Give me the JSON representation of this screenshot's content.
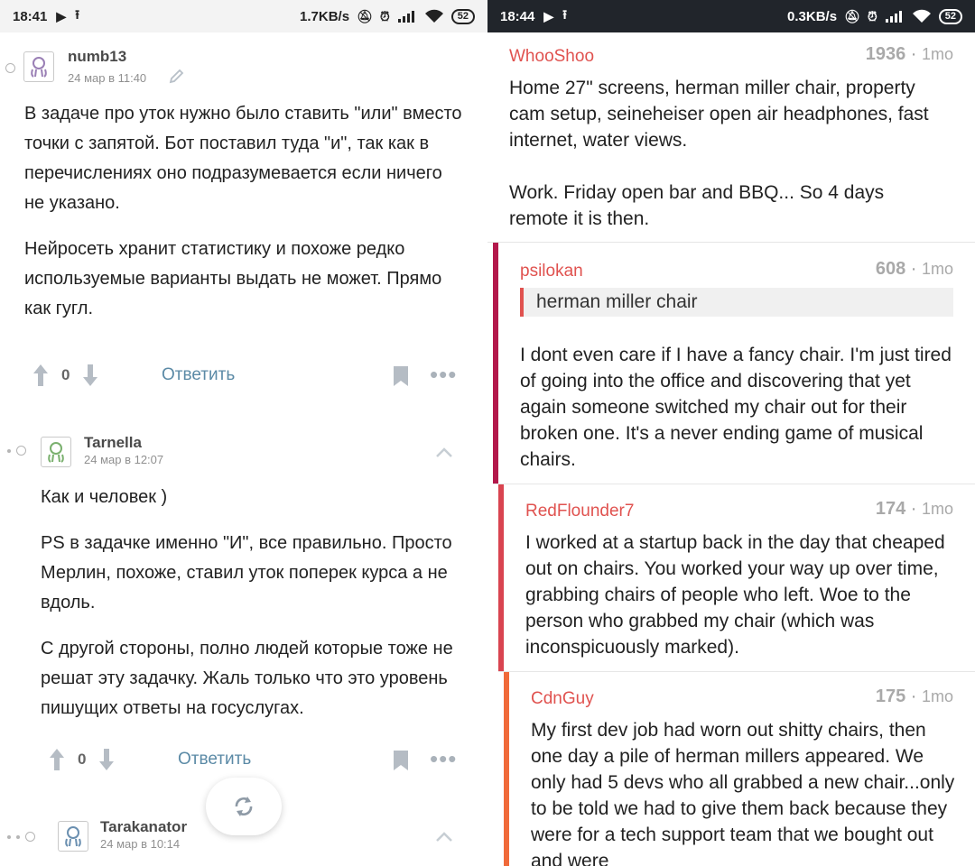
{
  "left": {
    "status": {
      "time": "18:41",
      "speed": "1.7KB/s",
      "battery": "52"
    },
    "comments": [
      {
        "author": "numb13",
        "date": "24 мар в 11:40",
        "paragraphs": [
          "В задаче про уток нужно было ставить \"или\" вместо точки с запятой. Бот поставил туда \"и\", так как в перечислениях оно подразумевается если ничего не указано.",
          "Нейросеть хранит статистику и похоже редко используемые варианты выдать не может. Прямо как гугл."
        ],
        "votes": "0",
        "reply_label": "Ответить"
      },
      {
        "author": "Tarnella",
        "date": "24 мар в 12:07",
        "paragraphs": [
          "Как и человек )",
          "PS в задачке именно \"И\", все правильно. Просто Мерлин, похоже, ставил уток поперек курса а не вдоль.",
          "С другой стороны, полно людей которые тоже не решат эту задачку. Жаль только что это уровень пишущих ответы на госуслугах."
        ],
        "votes": "0",
        "reply_label": "Ответить"
      },
      {
        "author": "Tarakanator",
        "date": "24 мар в 10:14"
      }
    ]
  },
  "right": {
    "status": {
      "time": "18:44",
      "speed": "0.3KB/s",
      "battery": "52"
    },
    "comments": [
      {
        "author": "WhooShoo",
        "score": "1936",
        "age": "1mo",
        "paragraphs": [
          "Home 27\" screens, herman miller chair, property cam setup, seineheiser open air headphones, fast internet, water views.",
          "Work. Friday open bar and BBQ... So 4 days remote it is then."
        ]
      },
      {
        "author": "psilokan",
        "score": "608",
        "age": "1mo",
        "quote": "herman miller chair",
        "paragraphs": [
          "I dont even care if I have a fancy chair. I'm just tired of going into the office and discovering that yet again someone switched my chair out for their broken one. It's a never ending game of musical chairs."
        ]
      },
      {
        "author": "RedFlounder7",
        "score": "174",
        "age": "1mo",
        "paragraphs": [
          "I worked at a startup back in the day that cheaped out on chairs. You worked your way up over time, grabbing chairs of people who left. Woe to the person who grabbed my chair (which was inconspicuously marked)."
        ]
      },
      {
        "author": "CdnGuy",
        "score": "175",
        "age": "1mo",
        "paragraphs": [
          "My first dev job had worn out shitty chairs, then one day a pile of herman millers appeared. We only had 5 devs who all grabbed a new chair...only to be told we had to give them back because they were for a tech support team that we bought out and were"
        ]
      }
    ],
    "colors": {
      "author": "#e0524f",
      "depth1": "#b3184b",
      "depth2": "#d94450",
      "depth3": "#f06a3a"
    }
  }
}
